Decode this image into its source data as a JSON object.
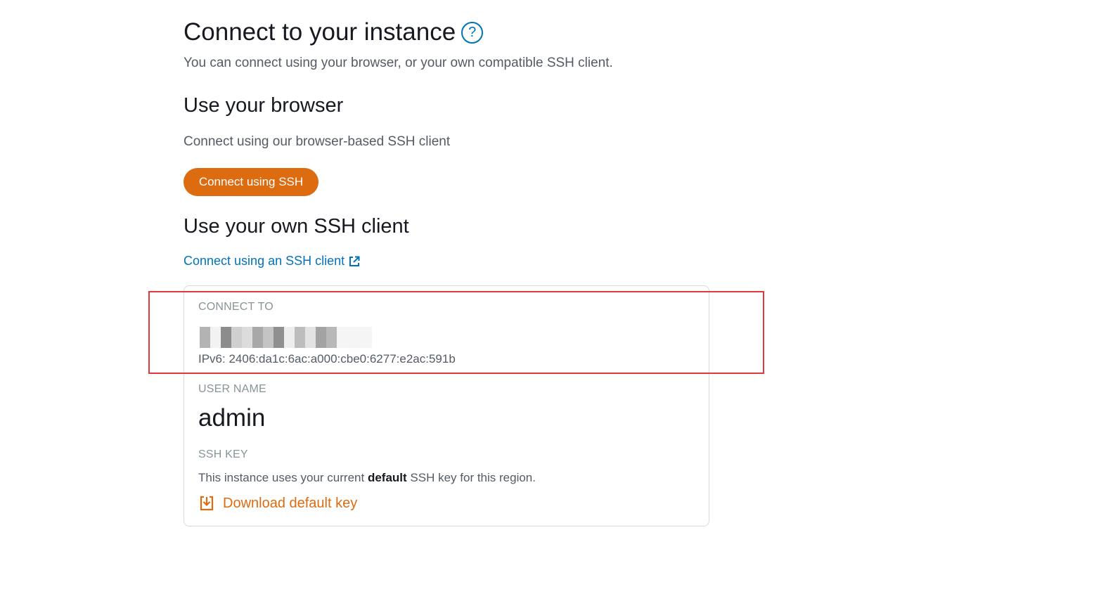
{
  "header": {
    "title": "Connect to your instance",
    "help_glyph": "?",
    "subtitle": "You can connect using your browser, or your own compatible SSH client."
  },
  "browser_section": {
    "heading": "Use your browser",
    "description": "Connect using our browser-based SSH client",
    "button_label": "Connect using SSH"
  },
  "ssh_client_section": {
    "heading": "Use your own SSH client",
    "link_label": "Connect using an SSH client"
  },
  "connection_card": {
    "connect_to_label": "CONNECT TO",
    "ipv6": "IPv6: 2406:da1c:6ac:a000:cbe0:6277:e2ac:591b",
    "user_name_label": "USER NAME",
    "user_name": "admin",
    "ssh_key_label": "SSH KEY",
    "key_desc_prefix": "This instance uses your current ",
    "key_desc_bold": "default",
    "key_desc_suffix": " SSH key for this region.",
    "download_label": "Download default key"
  },
  "colors": {
    "accent_orange": "#dd6b10",
    "link_blue": "#0073bb",
    "highlight_red": "#e0383e"
  },
  "icons": {
    "help": "help-icon",
    "external_link": "external-link-icon",
    "download": "download-icon"
  }
}
